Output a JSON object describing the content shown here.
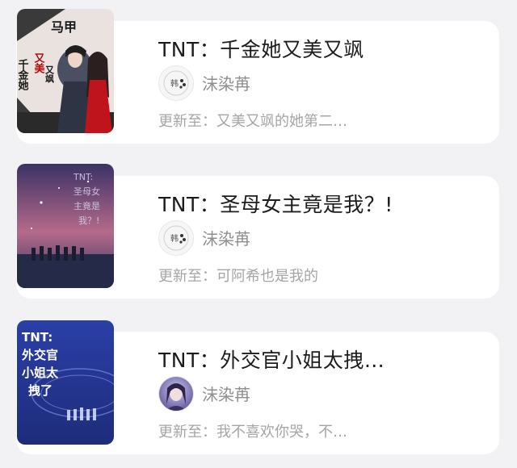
{
  "books": [
    {
      "title": "TNT：千金她又美又飒",
      "author": "沫染苒",
      "update": "更新至：又美又飒的她第二…",
      "cover_text": [
        "马甲",
        "千金她",
        "又美",
        "又飒"
      ]
    },
    {
      "title": "TNT：圣母女主竟是我？!",
      "author": "沫染苒",
      "update": "更新至：可阿希也是我的",
      "cover_text": [
        "TNT:",
        "圣母女",
        "主竟是",
        "我？!"
      ]
    },
    {
      "title": "TNT：外交官小姐太拽…",
      "author": "沫染苒",
      "update": "更新至：我不喜欢你哭，不…",
      "cover_text": [
        "TNT:",
        "外交官",
        "小姐太",
        "拽了"
      ]
    }
  ],
  "avatar_logo_text": "韩"
}
